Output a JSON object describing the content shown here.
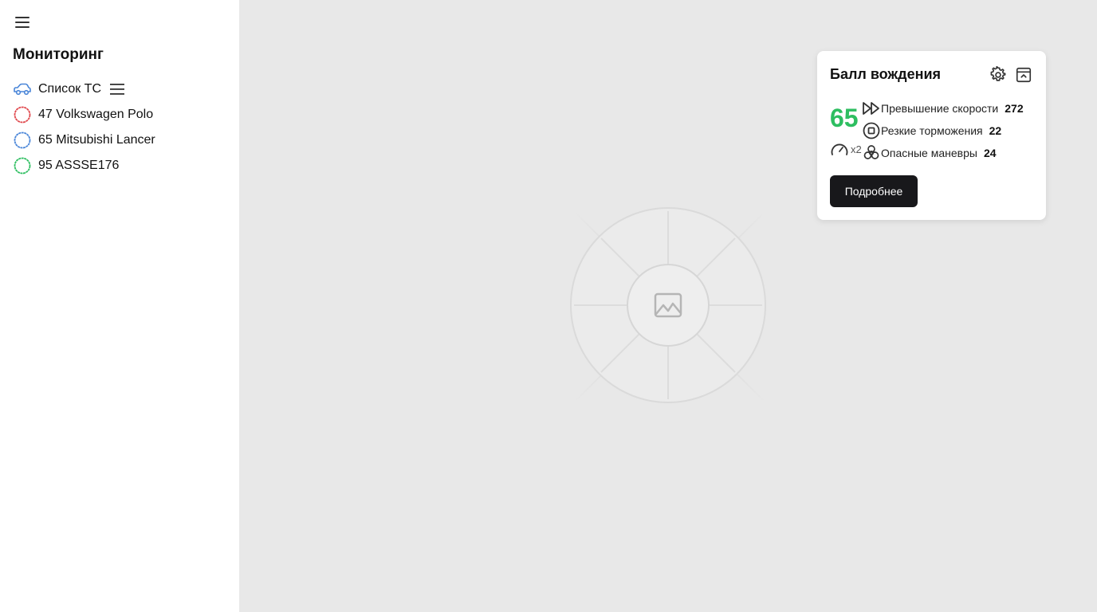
{
  "sidebar": {
    "title": "Мониторинг",
    "list_header": "Список ТС",
    "vehicles": [
      {
        "label": "47 Volkswagen Polo",
        "color": "#e0474c"
      },
      {
        "label": "65 Mitsubishi Lancer",
        "color": "#4a86d8"
      },
      {
        "label": "95 ASSSE176",
        "color": "#2dbe60"
      }
    ]
  },
  "card": {
    "title": "Балл вождения",
    "score": "65",
    "score_color": "#2dbe60",
    "multiplier": "x2",
    "metrics": [
      {
        "icon": "fast-forward-icon",
        "label": "Превышение скорости",
        "value": "272"
      },
      {
        "icon": "brake-icon",
        "label": "Резкие торможения",
        "value": "22"
      },
      {
        "icon": "biohazard-icon",
        "label": "Опасные маневры",
        "value": "24"
      }
    ],
    "more_button": "Подробнее"
  }
}
